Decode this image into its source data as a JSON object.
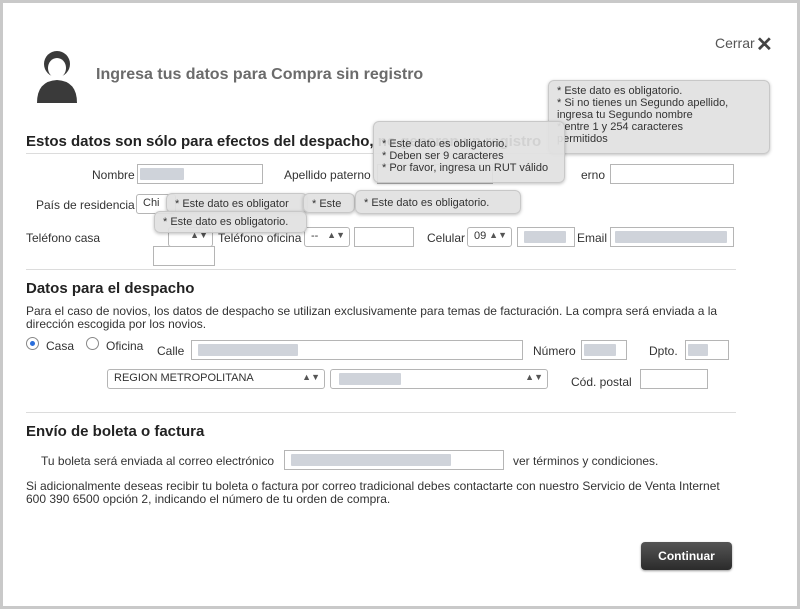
{
  "header": {
    "close_label": "Cerrar",
    "title": "Ingresa tus datos para Compra sin registro"
  },
  "section1": {
    "title": "Estos datos son sólo para efectos del despacho, no generan un registro",
    "nombre_label": "Nombre",
    "apellido_paterno_label": "Apellido paterno",
    "apellido_materno_label": "Apellido materno",
    "apellido_materno_visible": "erno",
    "pais_label": "País de residencia",
    "pais_value": "Chi",
    "telefono_casa_label": "Teléfono casa",
    "telefono_oficina_label": "Teléfono oficina",
    "oficina_code": "--",
    "celular_label": "Celular",
    "celular_code": "09",
    "email_label": "Email"
  },
  "tooltips": {
    "apellido_materno": [
      "* Este dato es obligatorio.",
      "* Si no tienes un Segundo apellido,",
      "  ingresa tu Segundo nombre",
      "* entre 1 y 254 caracteres",
      "  permitidos"
    ],
    "rut": [
      "* Este dato es obligatorio.",
      "* Deben ser 9 caracteres",
      "* Por favor, ingresa un RUT válido"
    ],
    "pais": "* Este dato es obligator",
    "casa": "* Este dato es obligatorio.",
    "oficina": "* Este",
    "phone": "* Este dato es obligatorio."
  },
  "section2": {
    "title": "Datos para el despacho",
    "description": "Para el caso de novios, los datos de despacho se utilizan exclusivamente para temas de facturación. La compra será enviada a la dirección escogida por los novios.",
    "casa_label": "Casa",
    "oficina_label": "Oficina",
    "calle_label": "Calle",
    "numero_label": "Número",
    "dpto_label": "Dpto.",
    "region_value": "REGION METROPOLITANA",
    "cod_postal_label": "Cód. postal"
  },
  "section3": {
    "title": "Envío de boleta o factura",
    "boleta_text": "Tu boleta será enviada al correo electrónico",
    "terms_text": "ver términos y condiciones.",
    "note": "Si adicionalmente deseas recibir tu boleta o factura por correo tradicional debes contactarte con nuestro Servicio de Venta Internet 600 390 6500 opción 2, indicando el número de tu orden de compra."
  },
  "footer": {
    "continue_label": "Continuar"
  },
  "colors": {
    "button_bg": "#2b2b2b",
    "header_text": "#6b6b6b",
    "radio_selected": "#2a6edb"
  }
}
